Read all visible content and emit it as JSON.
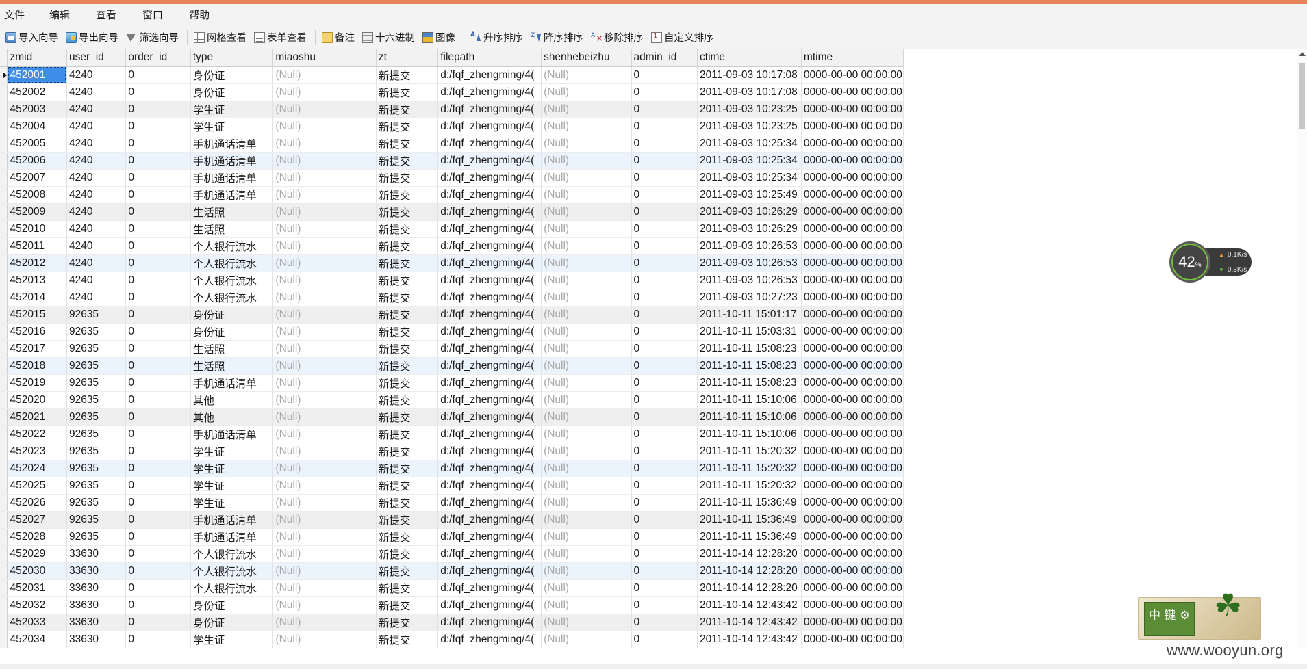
{
  "menu": [
    "文件",
    "编辑",
    "查看",
    "窗口",
    "帮助"
  ],
  "toolbar": [
    {
      "label": "导入向导",
      "icon": "import-wizard-icon",
      "cls": "ic-import"
    },
    {
      "label": "导出向导",
      "icon": "export-wizard-icon",
      "cls": "ic-export"
    },
    {
      "label": "筛选向导",
      "icon": "filter-icon",
      "cls": "ic-filter"
    },
    {
      "sep": true
    },
    {
      "label": "网格查看",
      "icon": "grid-view-icon",
      "cls": "ic-grid"
    },
    {
      "label": "表单查看",
      "icon": "form-view-icon",
      "cls": "ic-form"
    },
    {
      "sep": true
    },
    {
      "label": "备注",
      "icon": "memo-icon",
      "cls": "ic-memo"
    },
    {
      "label": "十六进制",
      "icon": "hex-icon",
      "cls": "ic-hex"
    },
    {
      "label": "图像",
      "icon": "image-icon",
      "cls": "ic-image"
    },
    {
      "sep": true
    },
    {
      "label": "升序排序",
      "icon": "sort-ascending-icon",
      "cls": "ic-sort"
    },
    {
      "label": "降序排序",
      "icon": "sort-descending-icon",
      "cls": "ic-sortdesc"
    },
    {
      "label": "移除排序",
      "icon": "remove-sort-icon",
      "cls": "ic-sortremove"
    },
    {
      "label": "自定义排序",
      "icon": "custom-sort-icon",
      "cls": "ic-custom"
    }
  ],
  "grid": {
    "columns": [
      "zmid",
      "user_id",
      "order_id",
      "type",
      "miaoshu",
      "zt",
      "filepath",
      "shenhebeizhu",
      "admin_id",
      "ctime",
      "mtime"
    ],
    "rows": [
      [
        "452001",
        "4240",
        "0",
        "身份证",
        "(Null)",
        "新提交",
        "d:/fqf_zhengming/4(",
        "(Null)",
        "0",
        "2011-09-03 10:17:08",
        "0000-00-00 00:00:00"
      ],
      [
        "452002",
        "4240",
        "0",
        "身份证",
        "(Null)",
        "新提交",
        "d:/fqf_zhengming/4(",
        "(Null)",
        "0",
        "2011-09-03 10:17:08",
        "0000-00-00 00:00:00"
      ],
      [
        "452003",
        "4240",
        "0",
        "学生证",
        "(Null)",
        "新提交",
        "d:/fqf_zhengming/4(",
        "(Null)",
        "0",
        "2011-09-03 10:23:25",
        "0000-00-00 00:00:00"
      ],
      [
        "452004",
        "4240",
        "0",
        "学生证",
        "(Null)",
        "新提交",
        "d:/fqf_zhengming/4(",
        "(Null)",
        "0",
        "2011-09-03 10:23:25",
        "0000-00-00 00:00:00"
      ],
      [
        "452005",
        "4240",
        "0",
        "手机通话清单",
        "(Null)",
        "新提交",
        "d:/fqf_zhengming/4(",
        "(Null)",
        "0",
        "2011-09-03 10:25:34",
        "0000-00-00 00:00:00"
      ],
      [
        "452006",
        "4240",
        "0",
        "手机通话清单",
        "(Null)",
        "新提交",
        "d:/fqf_zhengming/4(",
        "(Null)",
        "0",
        "2011-09-03 10:25:34",
        "0000-00-00 00:00:00"
      ],
      [
        "452007",
        "4240",
        "0",
        "手机通话清单",
        "(Null)",
        "新提交",
        "d:/fqf_zhengming/4(",
        "(Null)",
        "0",
        "2011-09-03 10:25:34",
        "0000-00-00 00:00:00"
      ],
      [
        "452008",
        "4240",
        "0",
        "手机通话清单",
        "(Null)",
        "新提交",
        "d:/fqf_zhengming/4(",
        "(Null)",
        "0",
        "2011-09-03 10:25:49",
        "0000-00-00 00:00:00"
      ],
      [
        "452009",
        "4240",
        "0",
        "生活照",
        "(Null)",
        "新提交",
        "d:/fqf_zhengming/4(",
        "(Null)",
        "0",
        "2011-09-03 10:26:29",
        "0000-00-00 00:00:00"
      ],
      [
        "452010",
        "4240",
        "0",
        "生活照",
        "(Null)",
        "新提交",
        "d:/fqf_zhengming/4(",
        "(Null)",
        "0",
        "2011-09-03 10:26:29",
        "0000-00-00 00:00:00"
      ],
      [
        "452011",
        "4240",
        "0",
        "个人银行流水",
        "(Null)",
        "新提交",
        "d:/fqf_zhengming/4(",
        "(Null)",
        "0",
        "2011-09-03 10:26:53",
        "0000-00-00 00:00:00"
      ],
      [
        "452012",
        "4240",
        "0",
        "个人银行流水",
        "(Null)",
        "新提交",
        "d:/fqf_zhengming/4(",
        "(Null)",
        "0",
        "2011-09-03 10:26:53",
        "0000-00-00 00:00:00"
      ],
      [
        "452013",
        "4240",
        "0",
        "个人银行流水",
        "(Null)",
        "新提交",
        "d:/fqf_zhengming/4(",
        "(Null)",
        "0",
        "2011-09-03 10:26:53",
        "0000-00-00 00:00:00"
      ],
      [
        "452014",
        "4240",
        "0",
        "个人银行流水",
        "(Null)",
        "新提交",
        "d:/fqf_zhengming/4(",
        "(Null)",
        "0",
        "2011-09-03 10:27:23",
        "0000-00-00 00:00:00"
      ],
      [
        "452015",
        "92635",
        "0",
        "身份证",
        "(Null)",
        "新提交",
        "d:/fqf_zhengming/4(",
        "(Null)",
        "0",
        "2011-10-11 15:01:17",
        "0000-00-00 00:00:00"
      ],
      [
        "452016",
        "92635",
        "0",
        "身份证",
        "(Null)",
        "新提交",
        "d:/fqf_zhengming/4(",
        "(Null)",
        "0",
        "2011-10-11 15:03:31",
        "0000-00-00 00:00:00"
      ],
      [
        "452017",
        "92635",
        "0",
        "生活照",
        "(Null)",
        "新提交",
        "d:/fqf_zhengming/4(",
        "(Null)",
        "0",
        "2011-10-11 15:08:23",
        "0000-00-00 00:00:00"
      ],
      [
        "452018",
        "92635",
        "0",
        "生活照",
        "(Null)",
        "新提交",
        "d:/fqf_zhengming/4(",
        "(Null)",
        "0",
        "2011-10-11 15:08:23",
        "0000-00-00 00:00:00"
      ],
      [
        "452019",
        "92635",
        "0",
        "手机通话清单",
        "(Null)",
        "新提交",
        "d:/fqf_zhengming/4(",
        "(Null)",
        "0",
        "2011-10-11 15:08:23",
        "0000-00-00 00:00:00"
      ],
      [
        "452020",
        "92635",
        "0",
        "其他",
        "(Null)",
        "新提交",
        "d:/fqf_zhengming/4(",
        "(Null)",
        "0",
        "2011-10-11 15:10:06",
        "0000-00-00 00:00:00"
      ],
      [
        "452021",
        "92635",
        "0",
        "其他",
        "(Null)",
        "新提交",
        "d:/fqf_zhengming/4(",
        "(Null)",
        "0",
        "2011-10-11 15:10:06",
        "0000-00-00 00:00:00"
      ],
      [
        "452022",
        "92635",
        "0",
        "手机通话清单",
        "(Null)",
        "新提交",
        "d:/fqf_zhengming/4(",
        "(Null)",
        "0",
        "2011-10-11 15:10:06",
        "0000-00-00 00:00:00"
      ],
      [
        "452023",
        "92635",
        "0",
        "学生证",
        "(Null)",
        "新提交",
        "d:/fqf_zhengming/4(",
        "(Null)",
        "0",
        "2011-10-11 15:20:32",
        "0000-00-00 00:00:00"
      ],
      [
        "452024",
        "92635",
        "0",
        "学生证",
        "(Null)",
        "新提交",
        "d:/fqf_zhengming/4(",
        "(Null)",
        "0",
        "2011-10-11 15:20:32",
        "0000-00-00 00:00:00"
      ],
      [
        "452025",
        "92635",
        "0",
        "学生证",
        "(Null)",
        "新提交",
        "d:/fqf_zhengming/4(",
        "(Null)",
        "0",
        "2011-10-11 15:20:32",
        "0000-00-00 00:00:00"
      ],
      [
        "452026",
        "92635",
        "0",
        "学生证",
        "(Null)",
        "新提交",
        "d:/fqf_zhengming/4(",
        "(Null)",
        "0",
        "2011-10-11 15:36:49",
        "0000-00-00 00:00:00"
      ],
      [
        "452027",
        "92635",
        "0",
        "手机通话清单",
        "(Null)",
        "新提交",
        "d:/fqf_zhengming/4(",
        "(Null)",
        "0",
        "2011-10-11 15:36:49",
        "0000-00-00 00:00:00"
      ],
      [
        "452028",
        "92635",
        "0",
        "手机通话清单",
        "(Null)",
        "新提交",
        "d:/fqf_zhengming/4(",
        "(Null)",
        "0",
        "2011-10-11 15:36:49",
        "0000-00-00 00:00:00"
      ],
      [
        "452029",
        "33630",
        "0",
        "个人银行流水",
        "(Null)",
        "新提交",
        "d:/fqf_zhengming/4(",
        "(Null)",
        "0",
        "2011-10-14 12:28:20",
        "0000-00-00 00:00:00"
      ],
      [
        "452030",
        "33630",
        "0",
        "个人银行流水",
        "(Null)",
        "新提交",
        "d:/fqf_zhengming/4(",
        "(Null)",
        "0",
        "2011-10-14 12:28:20",
        "0000-00-00 00:00:00"
      ],
      [
        "452031",
        "33630",
        "0",
        "个人银行流水",
        "(Null)",
        "新提交",
        "d:/fqf_zhengming/4(",
        "(Null)",
        "0",
        "2011-10-14 12:28:20",
        "0000-00-00 00:00:00"
      ],
      [
        "452032",
        "33630",
        "0",
        "身份证",
        "(Null)",
        "新提交",
        "d:/fqf_zhengming/4(",
        "(Null)",
        "0",
        "2011-10-14 12:43:42",
        "0000-00-00 00:00:00"
      ],
      [
        "452033",
        "33630",
        "0",
        "身份证",
        "(Null)",
        "新提交",
        "d:/fqf_zhengming/4(",
        "(Null)",
        "0",
        "2011-10-14 12:43:42",
        "0000-00-00 00:00:00"
      ],
      [
        "452034",
        "33630",
        "0",
        "学生证",
        "(Null)",
        "新提交",
        "d:/fqf_zhengming/4(",
        "(Null)",
        "0",
        "2011-10-14 12:43:42",
        "0000-00-00 00:00:00"
      ]
    ],
    "row_shading": [
      "w",
      "w",
      "o",
      "w",
      "w",
      "b",
      "w",
      "w",
      "o",
      "w",
      "w",
      "b",
      "w",
      "w",
      "o",
      "w",
      "w",
      "b",
      "w",
      "w",
      "o",
      "w",
      "w",
      "b",
      "w",
      "w",
      "o",
      "w",
      "w",
      "b",
      "w",
      "w",
      "o",
      "w"
    ],
    "selected_row": 0
  },
  "speed_widget": {
    "percent": "42",
    "percent_unit": "%",
    "upload": "0.1",
    "download": "0.3",
    "unit": "K/s",
    "upload_color": "#f0a030",
    "download_color": "#60c040"
  },
  "ime_widget": {
    "mode": "中",
    "key_label": "键"
  },
  "watermark": "www.wooyun.org"
}
